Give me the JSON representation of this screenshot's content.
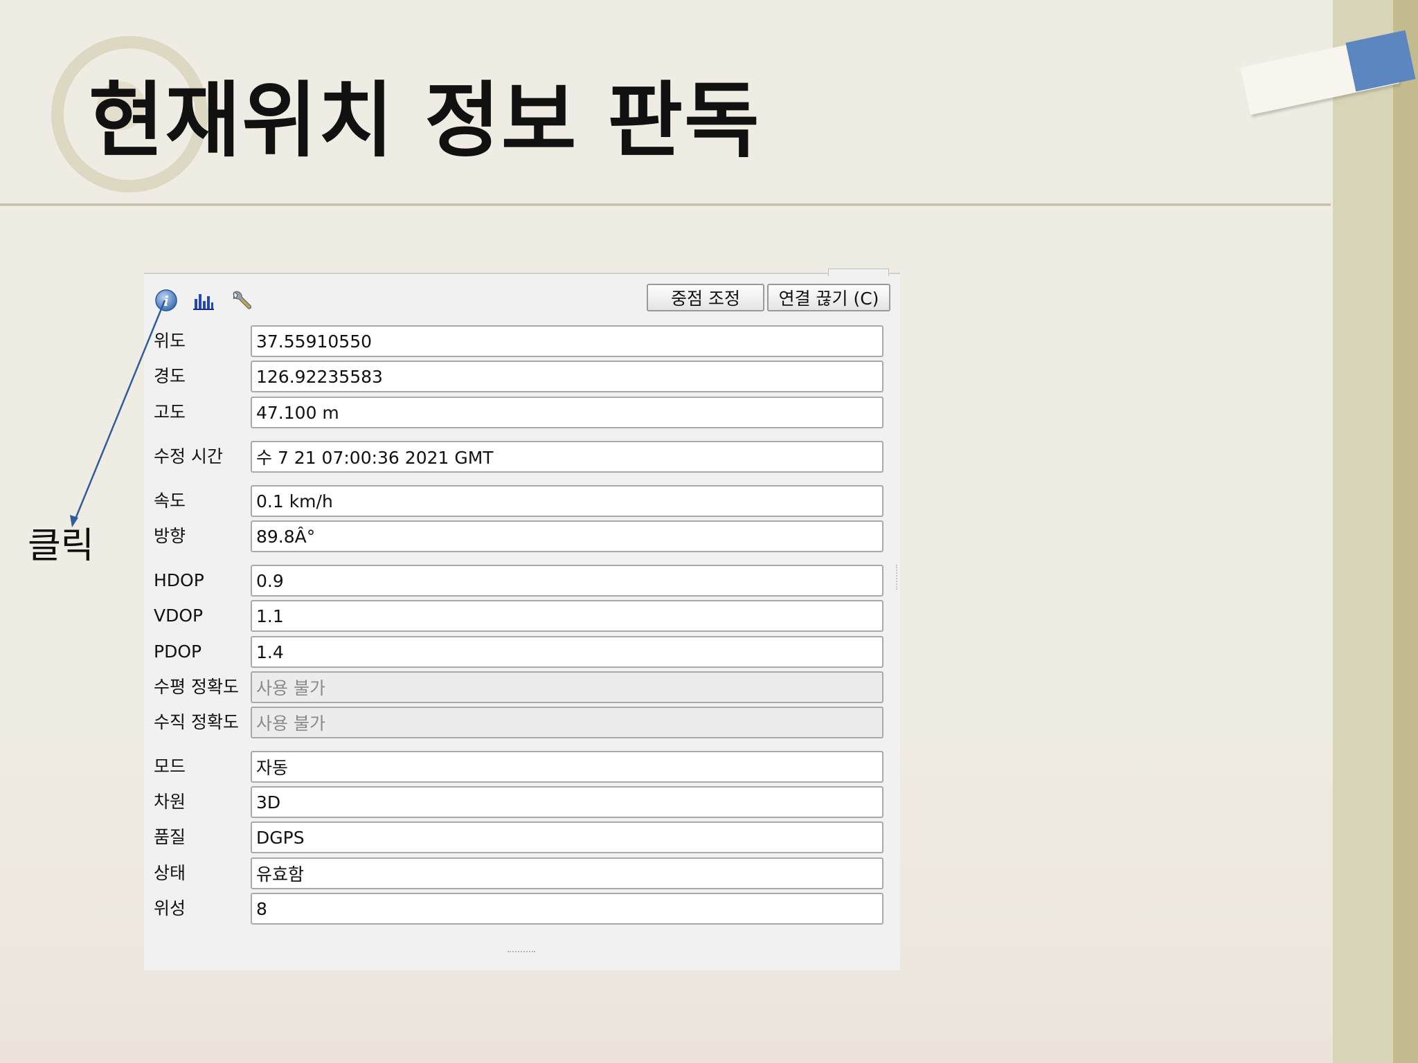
{
  "slide": {
    "title": "현재위치 정보 판독",
    "annotation": "클릭"
  },
  "colors": {
    "pointer_line": "#2e5d9c",
    "accent_blue": "#5b86c0",
    "info_icon": "#3f6fb4",
    "chart_icon": "#2347b8"
  },
  "toolbar": {
    "icons": [
      "info-icon",
      "chart-icon",
      "wrench-icon"
    ],
    "center_button": "중점 조정",
    "disconnect_button": "연결 끊기 (C)"
  },
  "fields": [
    {
      "label": "위도",
      "value": "37.55910550",
      "disabled": false
    },
    {
      "label": "경도",
      "value": "126.92235583",
      "disabled": false
    },
    {
      "label": "고도",
      "value": "47.100 m",
      "disabled": false
    },
    {
      "label": "수정 시간",
      "value": "수 7 21 07:00:36 2021 GMT",
      "disabled": false
    },
    {
      "label": "속도",
      "value": "0.1 km/h",
      "disabled": false
    },
    {
      "label": "방향",
      "value": "89.8Â°",
      "disabled": false
    },
    {
      "label": "HDOP",
      "value": "0.9",
      "disabled": false
    },
    {
      "label": "VDOP",
      "value": "1.1",
      "disabled": false
    },
    {
      "label": "PDOP",
      "value": "1.4",
      "disabled": false
    },
    {
      "label": "수평 정확도",
      "value": "사용 불가",
      "disabled": true
    },
    {
      "label": "수직 정확도",
      "value": "사용 불가",
      "disabled": true
    },
    {
      "label": "모드",
      "value": "자동",
      "disabled": false
    },
    {
      "label": "차원",
      "value": "3D",
      "disabled": false
    },
    {
      "label": "품질",
      "value": "DGPS",
      "disabled": false
    },
    {
      "label": "상태",
      "value": "유효함",
      "disabled": false
    },
    {
      "label": "위성",
      "value": "8",
      "disabled": false
    }
  ]
}
